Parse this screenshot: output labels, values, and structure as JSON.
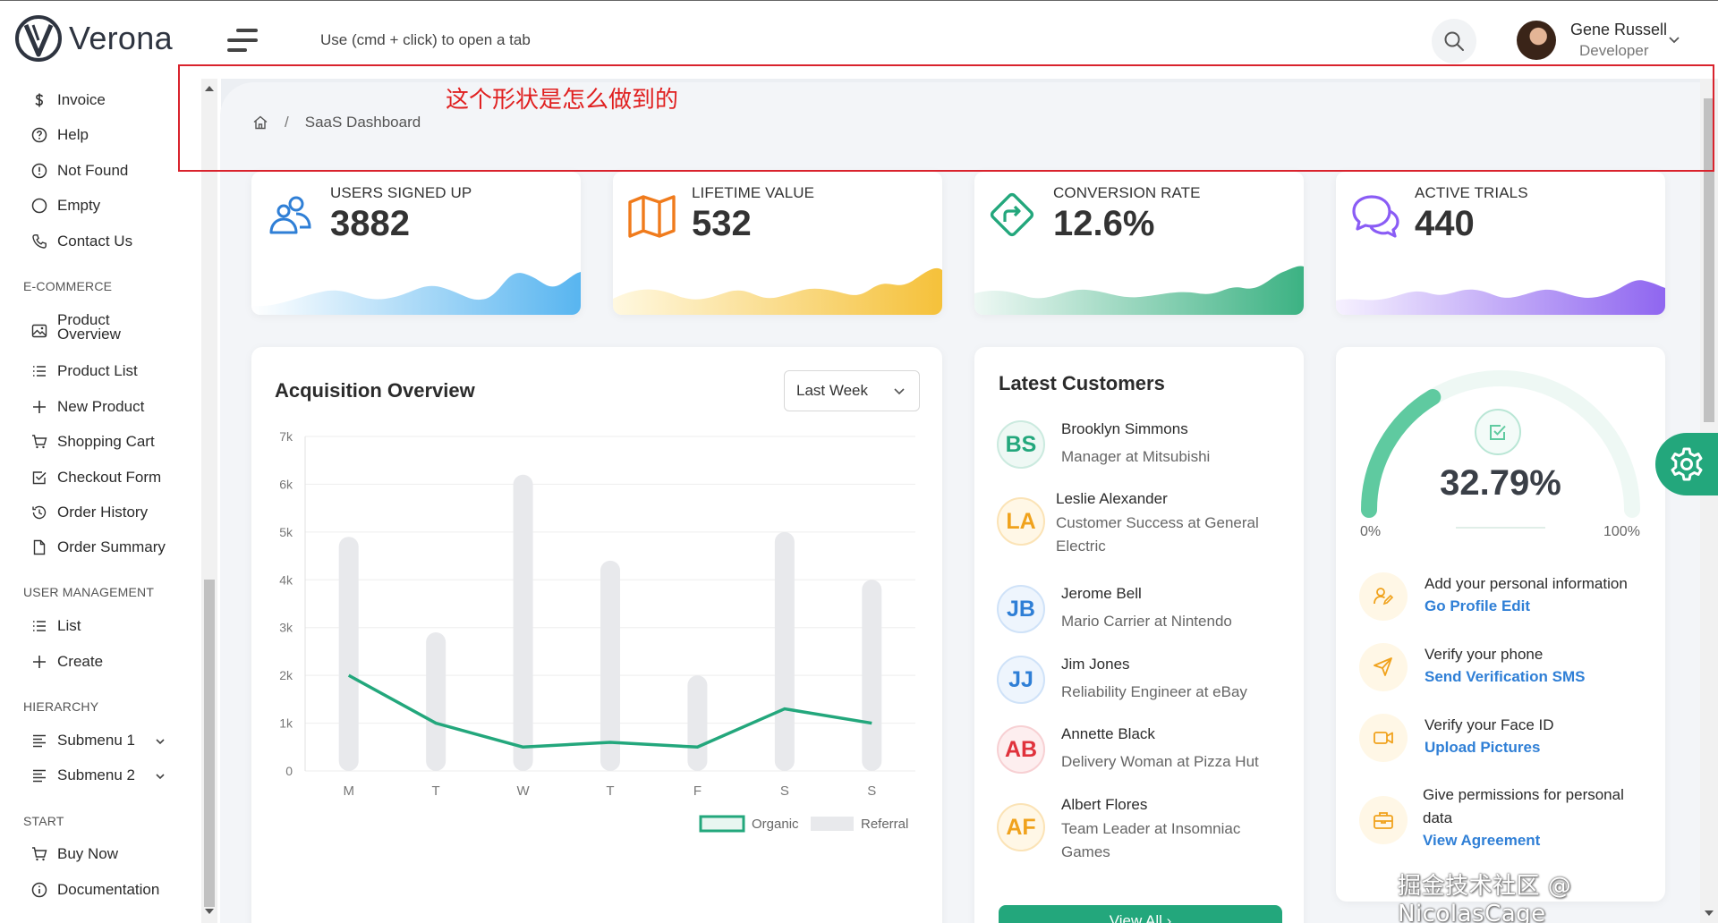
{
  "header": {
    "brand": "Verona",
    "hint": "Use (cmd + click) to open a tab",
    "user": {
      "name": "Gene Russell",
      "role": "Developer"
    }
  },
  "sidebar": {
    "items_top": [
      {
        "label": "Invoice",
        "icon": "dollar-icon"
      },
      {
        "label": "Help",
        "icon": "question-circle-icon"
      },
      {
        "label": "Not Found",
        "icon": "exclamation-circle-icon"
      },
      {
        "label": "Empty",
        "icon": "circle-icon"
      },
      {
        "label": "Contact Us",
        "icon": "phone-icon"
      }
    ],
    "ecommerce_heading": "E-COMMERCE",
    "ecommerce": [
      {
        "label_line1": "Product",
        "label_line2": "Overview",
        "icon": "image-icon"
      },
      {
        "label": "Product List",
        "icon": "list-icon"
      },
      {
        "label": "New Product",
        "icon": "plus-icon"
      },
      {
        "label": "Shopping Cart",
        "icon": "cart-icon"
      },
      {
        "label": "Checkout Form",
        "icon": "check-square-icon"
      },
      {
        "label": "Order History",
        "icon": "history-icon"
      },
      {
        "label": "Order Summary",
        "icon": "file-icon"
      }
    ],
    "user_mgmt_heading": "USER MANAGEMENT",
    "user_mgmt": [
      {
        "label": "List",
        "icon": "list-icon"
      },
      {
        "label": "Create",
        "icon": "plus-icon"
      }
    ],
    "hierarchy_heading": "HIERARCHY",
    "hierarchy": [
      {
        "label": "Submenu 1",
        "icon": "align-left-icon"
      },
      {
        "label": "Submenu 2",
        "icon": "align-left-icon"
      }
    ],
    "start_heading": "START",
    "start": [
      {
        "label": "Buy Now",
        "icon": "cart-icon"
      },
      {
        "label": "Documentation",
        "icon": "info-circle-icon"
      }
    ]
  },
  "breadcrumb": {
    "sep": "/",
    "current": "SaaS Dashboard"
  },
  "annotation": "这个形状是怎么做到的",
  "stats": [
    {
      "label": "USERS SIGNED UP",
      "value": "3882",
      "color": "#2f7fd6",
      "icon": "users-icon"
    },
    {
      "label": "LIFETIME VALUE",
      "value": "532",
      "color": "#f07b1c",
      "icon": "map-icon"
    },
    {
      "label": "CONVERSION RATE",
      "value": "12.6%",
      "color": "#23a77c",
      "icon": "directions-icon"
    },
    {
      "label": "ACTIVE TRIALS",
      "value": "440",
      "color": "#8a5cf5",
      "icon": "comments-icon"
    }
  ],
  "acquisition": {
    "title": "Acquisition Overview",
    "period": "Last Week",
    "legend": {
      "organic": "Organic",
      "referral": "Referral"
    }
  },
  "chart_data": {
    "type": "bar",
    "categories": [
      "M",
      "T",
      "W",
      "T",
      "F",
      "S",
      "S"
    ],
    "ylim": [
      0,
      7000
    ],
    "yticks": [
      "0",
      "1k",
      "2k",
      "3k",
      "4k",
      "5k",
      "6k",
      "7k"
    ],
    "series": [
      {
        "name": "Organic",
        "kind": "line",
        "values": [
          2000,
          1000,
          500,
          600,
          500,
          1300,
          1000
        ],
        "color": "#23a77c"
      },
      {
        "name": "Referral",
        "kind": "bar",
        "values": [
          4900,
          2900,
          6200,
          4400,
          2000,
          5000,
          4000
        ],
        "color": "#e8e9ec"
      }
    ]
  },
  "customers": {
    "title": "Latest Customers",
    "view_all": "View All",
    "list": [
      {
        "initials": "BS",
        "name": "Brooklyn Simmons",
        "role": "Manager at Mitsubishi",
        "color": "#23a77c",
        "bg": "#eef8f4"
      },
      {
        "initials": "LA",
        "name": "Leslie Alexander",
        "role": "Customer Success at General Electric",
        "color": "#f0a21c",
        "bg": "#fff7e6"
      },
      {
        "initials": "JB",
        "name": "Jerome Bell",
        "role": "Mario Carrier at Nintendo",
        "color": "#2f7fd6",
        "bg": "#eef5fd"
      },
      {
        "initials": "JJ",
        "name": "Jim Jones",
        "role": "Reliability Engineer at eBay",
        "color": "#2f7fd6",
        "bg": "#eef5fd"
      },
      {
        "initials": "AB",
        "name": "Annette Black",
        "role": "Delivery Woman at Pizza Hut",
        "color": "#e0323c",
        "bg": "#fdeeef"
      },
      {
        "initials": "AF",
        "name": "Albert Flores",
        "role": "Team Leader at Insomniac Games",
        "color": "#f0a21c",
        "bg": "#fff7e6"
      }
    ]
  },
  "progress": {
    "value_text": "32.79%",
    "fraction": 0.3279,
    "min_label": "0%",
    "max_label": "100%",
    "color": "#23a77c",
    "tasks": [
      {
        "desc": "Add your personal information",
        "link": "Go Profile Edit",
        "icon": "user-edit-icon"
      },
      {
        "desc": "Verify your phone",
        "link": "Send Verification SMS",
        "icon": "send-icon"
      },
      {
        "desc": "Verify your Face ID",
        "link": "Upload Pictures",
        "icon": "video-icon"
      },
      {
        "desc": "Give permissions for personal data",
        "link": "View Agreement",
        "icon": "briefcase-icon"
      }
    ]
  },
  "watermark": "掘金技术社区 @ NicolasCage"
}
